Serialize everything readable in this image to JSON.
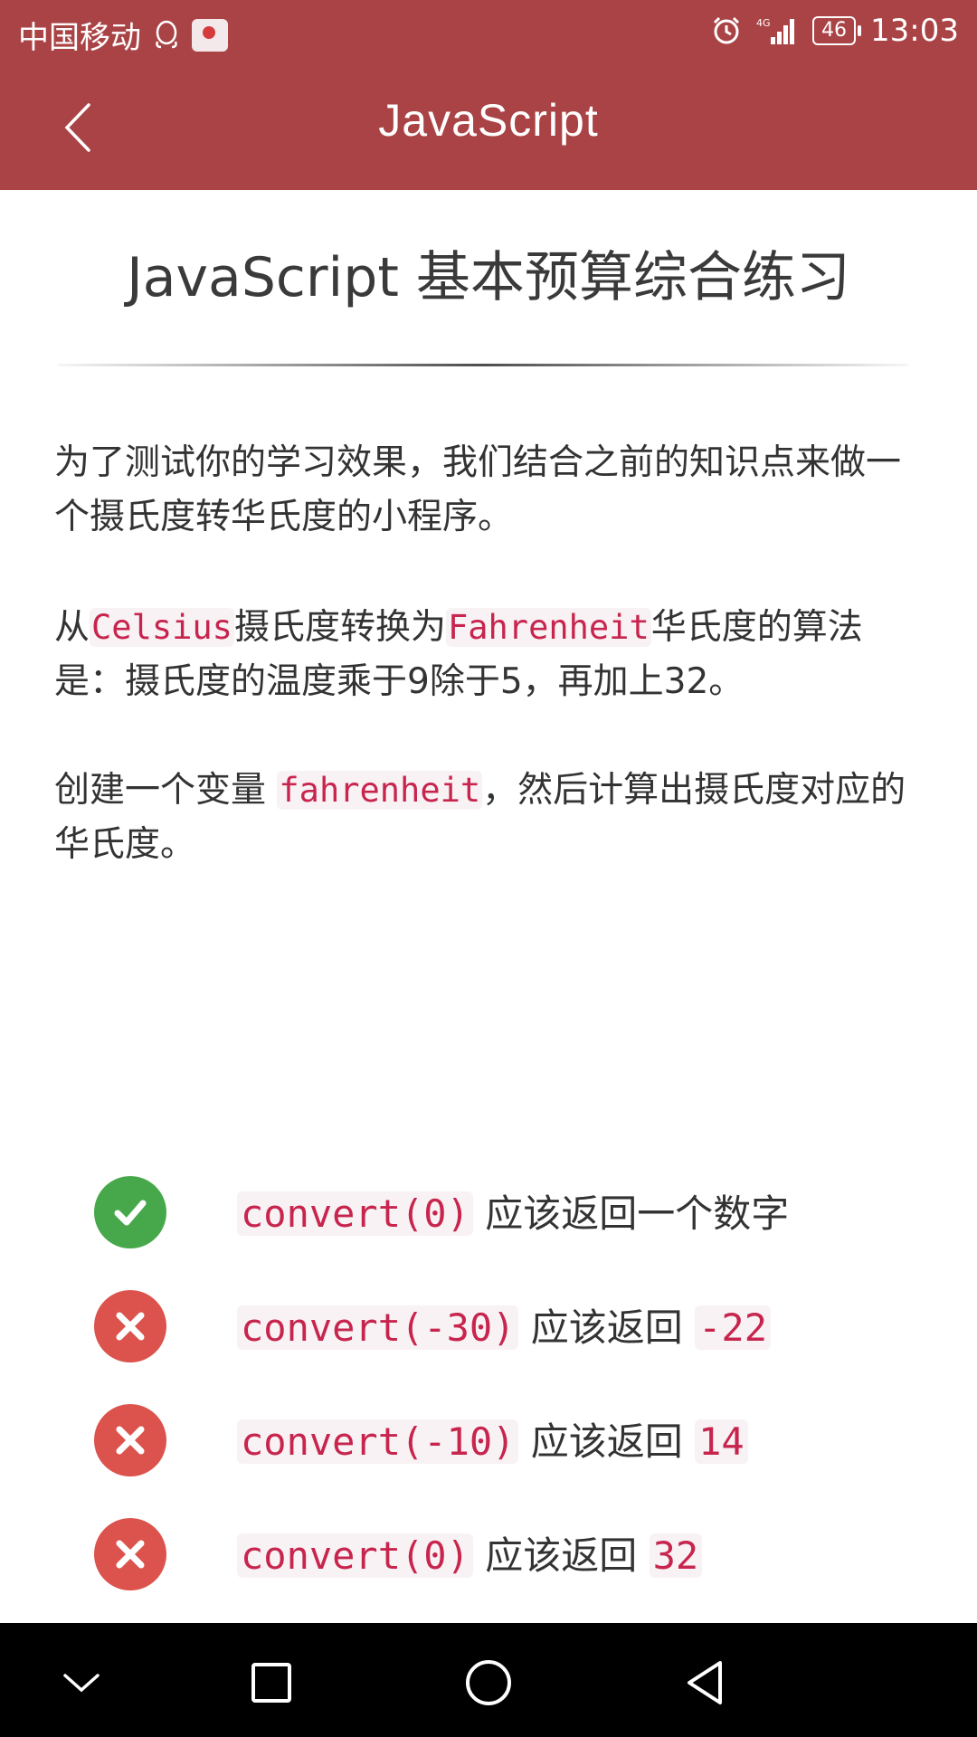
{
  "status_bar": {
    "carrier": "中国移动",
    "network": "4G",
    "battery": "46",
    "time": "13:03"
  },
  "app_bar": {
    "title": "JavaScript"
  },
  "page": {
    "title": "JavaScript 基本预算综合练习",
    "paragraphs": {
      "p1": "为了测试你的学习效果，我们结合之前的知识点来做一个摄氏度转华氏度的小程序。",
      "p2_a": "从",
      "p2_code1": "Celsius",
      "p2_b": "摄氏度转换为",
      "p2_code2": "Fahrenheit",
      "p2_c": "华氏度的算法是：摄氏度的温度乘于9除于5，再加上32。",
      "p3_a": "创建一个变量 ",
      "p3_code": "fahrenheit",
      "p3_b": "，然后计算出摄氏度对应的华氏度。"
    }
  },
  "tests": [
    {
      "status": "pass",
      "code": "convert(0)",
      "text": " 应该返回一个数字",
      "expected": ""
    },
    {
      "status": "fail",
      "code": "convert(-30)",
      "text": " 应该返回 ",
      "expected": "-22"
    },
    {
      "status": "fail",
      "code": "convert(-10)",
      "text": " 应该返回 ",
      "expected": "14"
    },
    {
      "status": "fail",
      "code": "convert(0)",
      "text": " 应该返回 ",
      "expected": "32"
    }
  ],
  "colors": {
    "header": "#aa4345",
    "pass": "#47a84b",
    "fail": "#db534c",
    "code": "#c7254e"
  },
  "icons": {
    "status_bar": [
      "qq-icon",
      "app-icon",
      "alarm-icon",
      "signal-icon",
      "battery-icon"
    ],
    "nav_bar": [
      "chevron-down-icon",
      "square-icon",
      "circle-icon",
      "triangle-back-icon"
    ]
  }
}
